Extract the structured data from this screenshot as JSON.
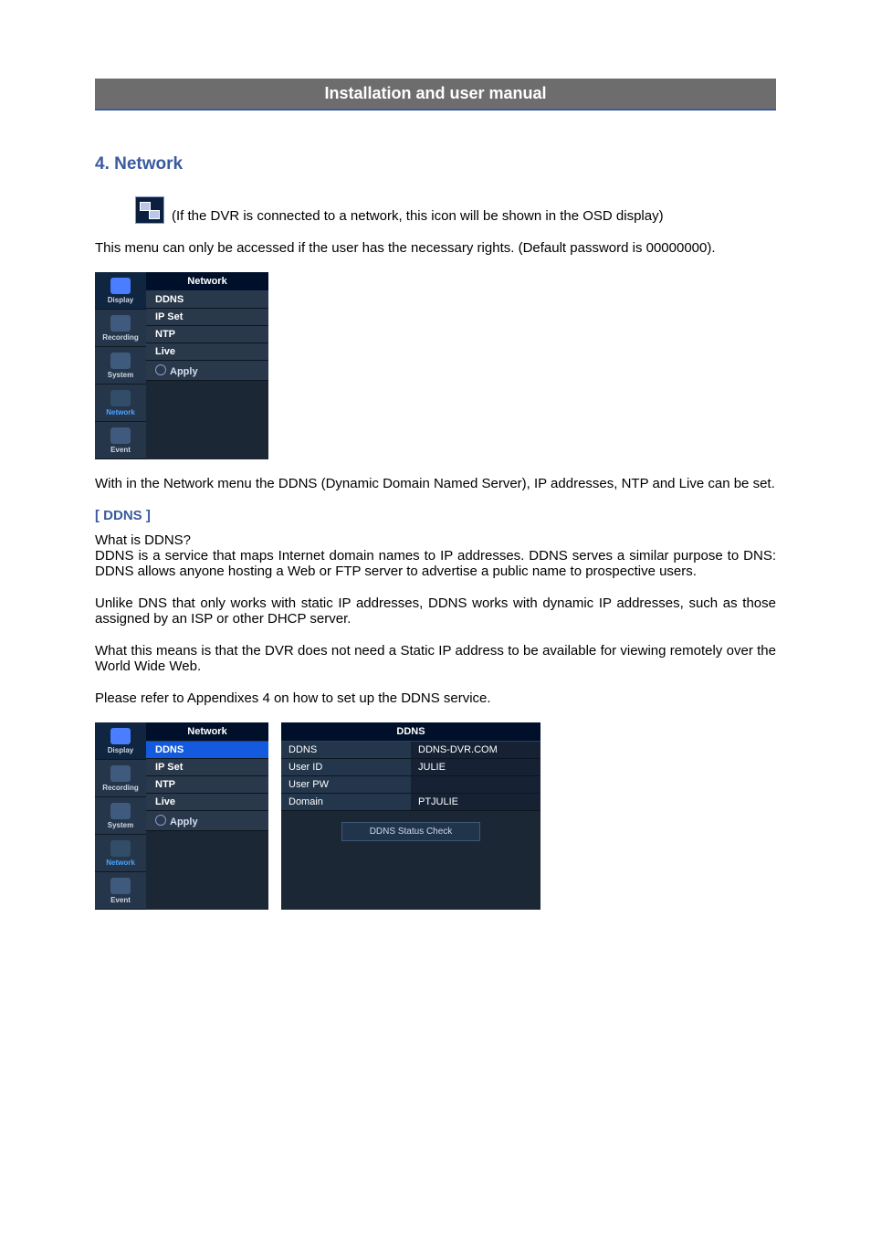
{
  "title_bar": "Installation and user manual",
  "section_heading": "4. Network",
  "icon_note": " (If the DVR is connected to a network, this icon will be shown in the OSD display)",
  "para1": "This menu can only be accessed if the user has the necessary rights. (Default password is 00000000).",
  "menu1": {
    "header": "Network",
    "sidebar": [
      "Display",
      "Recording",
      "System",
      "Network",
      "Event"
    ],
    "items": {
      "ddns": "DDNS",
      "ipset": "IP Set",
      "ntp": "NTP",
      "live": "Live",
      "apply": "Apply"
    }
  },
  "para2": "With in the Network menu the DDNS (Dynamic Domain Named Server), IP addresses, NTP and Live can be set.",
  "sub_heading": "[ DDNS ]",
  "para3a": "What is DDNS?",
  "para3b": "DDNS is a service that maps Internet domain names to IP addresses. DDNS serves a similar purpose to DNS: DDNS allows anyone hosting a Web or FTP server to advertise a public name to prospective users.",
  "para4": "Unlike DNS that only works with static IP addresses, DDNS works with dynamic IP addresses, such as those assigned by an ISP or other DHCP server.",
  "para5": "What this means is that the DVR does not need a Static IP address to be available for viewing remotely over the World Wide Web.",
  "para6": "Please refer to Appendixes 4 on how to set up the DDNS service.",
  "ddns": {
    "header": "DDNS",
    "rows": {
      "ddns_k": "DDNS",
      "ddns_v": "DDNS-DVR.COM",
      "uid_k": "User ID",
      "uid_v": "JULIE",
      "upw_k": "User PW",
      "upw_v": "",
      "dom_k": "Domain",
      "dom_v": "PTJULIE"
    },
    "button": "DDNS Status Check"
  }
}
